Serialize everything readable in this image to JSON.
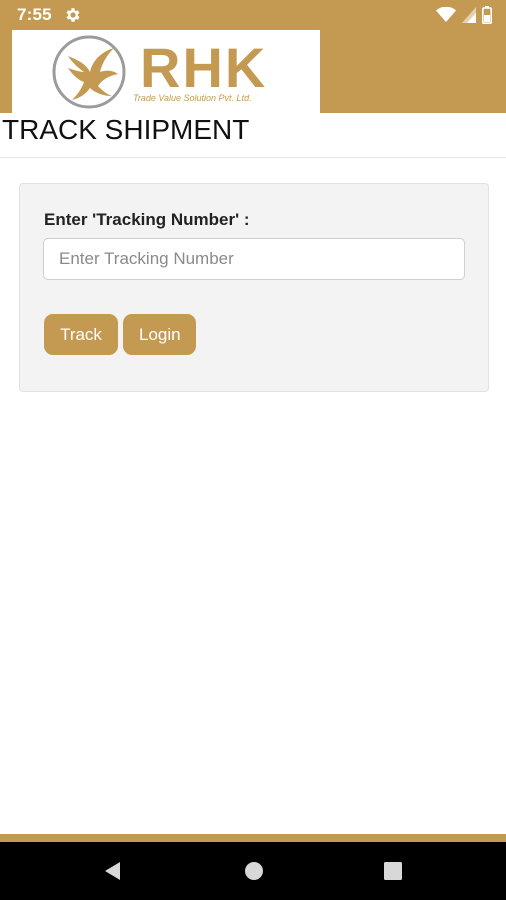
{
  "status_bar": {
    "time": "7:55",
    "icons": [
      "gear-icon",
      "wifi-icon",
      "signal-icon",
      "battery-icon"
    ]
  },
  "logo": {
    "name": "RHK",
    "tagline": "Trade Value Solution Pvt. Ltd."
  },
  "page": {
    "title": "TRACK SHIPMENT"
  },
  "track_form": {
    "label": "Enter 'Tracking Number' :",
    "input_value": "",
    "input_placeholder": "Enter Tracking Number",
    "track_button": "Track",
    "login_button": "Login"
  },
  "nav_bar": {
    "icons": [
      "back-icon",
      "home-icon",
      "recents-icon"
    ]
  },
  "colors": {
    "brand": "#c49a52",
    "card_bg": "#f3f3f3",
    "nav_bg": "#000000"
  }
}
